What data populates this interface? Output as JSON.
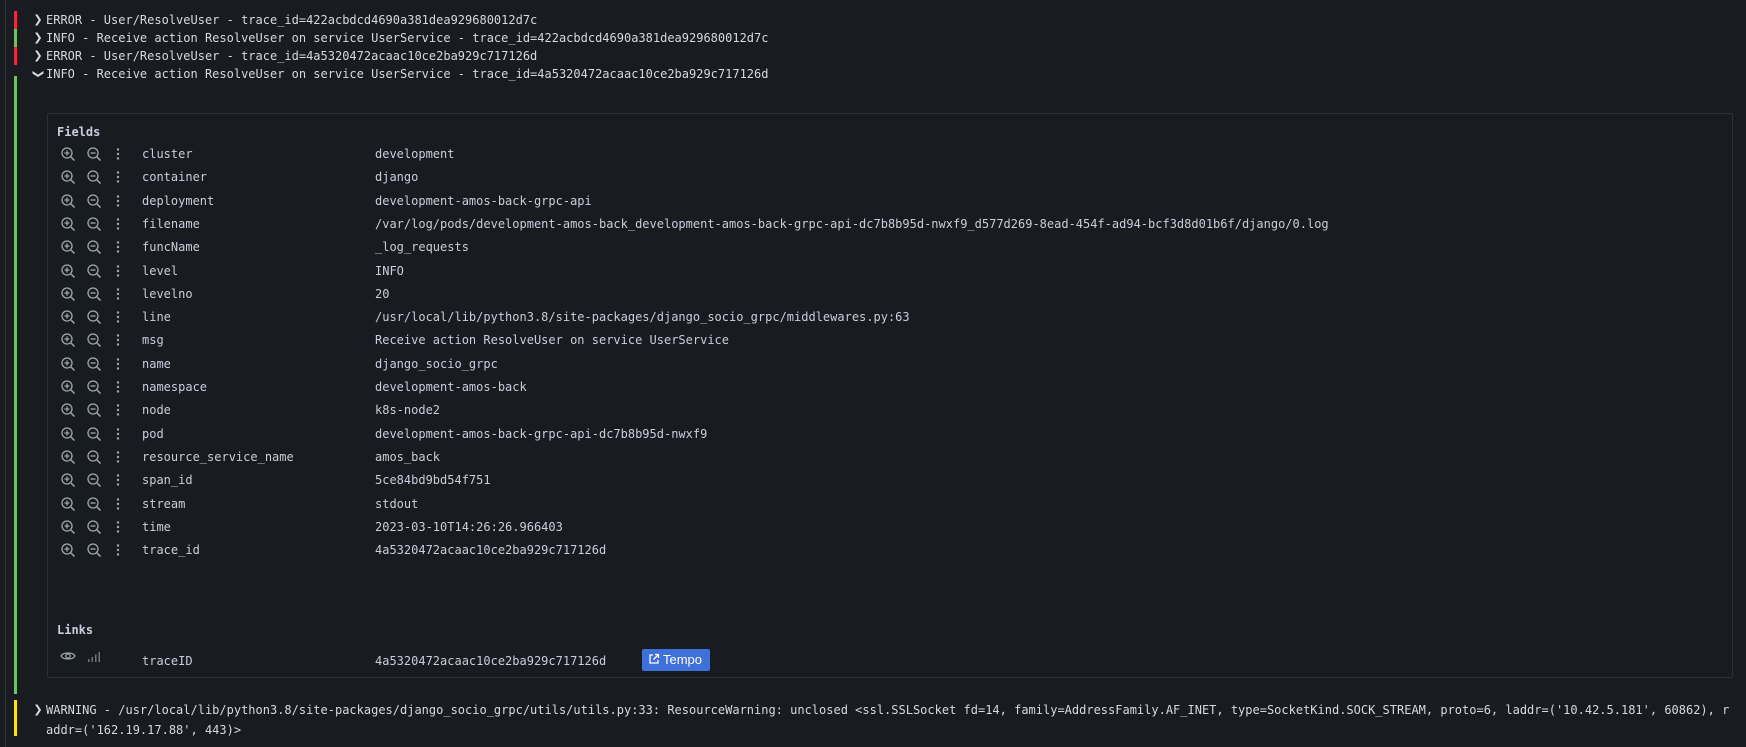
{
  "colors": {
    "error": "#e02f44",
    "info": "#73bf69",
    "warning": "#fade2a",
    "link_button": "#3d71d9"
  },
  "log_rows": [
    {
      "level": "error",
      "text": "ERROR - User/ResolveUser - trace_id=422acbdcd4690a381dea929680012d7c",
      "expanded": false
    },
    {
      "level": "info",
      "text": "INFO - Receive action ResolveUser on service UserService - trace_id=422acbdcd4690a381dea929680012d7c",
      "expanded": false
    },
    {
      "level": "error",
      "text": "ERROR - User/ResolveUser - trace_id=4a5320472acaac10ce2ba929c717126d",
      "expanded": false
    },
    {
      "level": "info",
      "text": "INFO - Receive action ResolveUser on service UserService - trace_id=4a5320472acaac10ce2ba929c717126d",
      "expanded": true
    }
  ],
  "details": {
    "fields_title": "Fields",
    "fields": [
      {
        "key": "cluster",
        "value": "development"
      },
      {
        "key": "container",
        "value": "django"
      },
      {
        "key": "deployment",
        "value": "development-amos-back-grpc-api"
      },
      {
        "key": "filename",
        "value": "/var/log/pods/development-amos-back_development-amos-back-grpc-api-dc7b8b95d-nwxf9_d577d269-8ead-454f-ad94-bcf3d8d01b6f/django/0.log"
      },
      {
        "key": "funcName",
        "value": "_log_requests"
      },
      {
        "key": "level",
        "value": "INFO"
      },
      {
        "key": "levelno",
        "value": "20"
      },
      {
        "key": "line",
        "value": "/usr/local/lib/python3.8/site-packages/django_socio_grpc/middlewares.py:63"
      },
      {
        "key": "msg",
        "value": "Receive action ResolveUser on service UserService"
      },
      {
        "key": "name",
        "value": "django_socio_grpc"
      },
      {
        "key": "namespace",
        "value": "development-amos-back"
      },
      {
        "key": "node",
        "value": "k8s-node2"
      },
      {
        "key": "pod",
        "value": "development-amos-back-grpc-api-dc7b8b95d-nwxf9"
      },
      {
        "key": "resource_service_name",
        "value": "amos_back"
      },
      {
        "key": "span_id",
        "value": "5ce84bd9bd54f751"
      },
      {
        "key": "stream",
        "value": "stdout"
      },
      {
        "key": "time",
        "value": "2023-03-10T14:26:26.966403"
      },
      {
        "key": "trace_id",
        "value": "4a5320472acaac10ce2ba929c717126d"
      }
    ],
    "links_title": "Links",
    "links": [
      {
        "key": "traceID",
        "value": "4a5320472acaac10ce2ba929c717126d",
        "button_label": "Tempo",
        "button_icon": "external-link-icon"
      }
    ]
  },
  "warning_row": {
    "level": "warning",
    "text": "WARNING - /usr/local/lib/python3.8/site-packages/django_socio_grpc/utils/utils.py:33: ResourceWarning: unclosed <ssl.SSLSocket fd=14, family=AddressFamily.AF_INET, type=SocketKind.SOCK_STREAM, proto=6, laddr=('10.42.5.181', 60862), raddr=('162.19.17.88', 443)>"
  }
}
